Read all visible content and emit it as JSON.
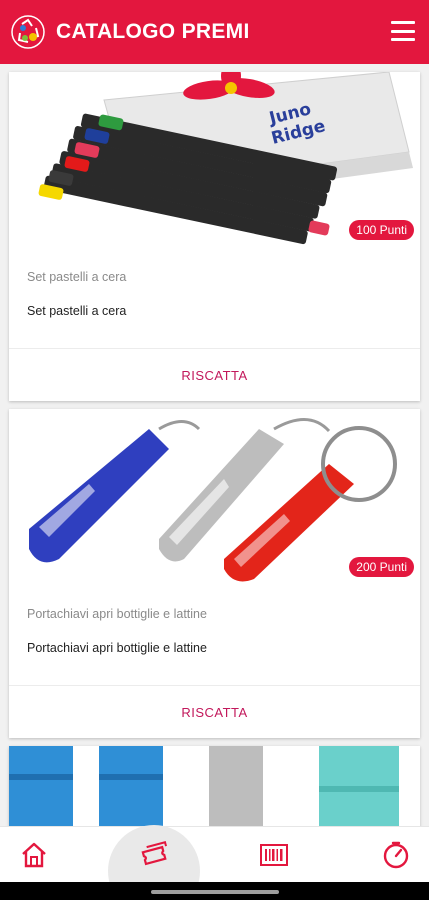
{
  "appbar": {
    "title": "CATALOGO PREMI",
    "logo_icon": "recycle-logo-icon",
    "menu_icon": "hamburger-menu-icon",
    "background": "#e3173e"
  },
  "catalog": {
    "items": [
      {
        "points_badge": "100 Punti",
        "subtitle": "Set pastelli a cera",
        "description": "Set pastelli a cera",
        "action_label": "RISCATTA",
        "image_icon": "crayon-set-image"
      },
      {
        "points_badge": "200 Punti",
        "subtitle": "Portachiavi apri bottiglie e lattine",
        "description": "Portachiavi apri bottiglie e lattine",
        "action_label": "RISCATTA",
        "image_icon": "bottle-opener-keychain-image"
      },
      {
        "image_icon": "highlighter-markers-image"
      }
    ]
  },
  "bottom_nav": {
    "items": [
      {
        "icon": "home-icon",
        "active": false
      },
      {
        "icon": "tickets-icon",
        "active": true
      },
      {
        "icon": "barcode-icon",
        "active": false
      },
      {
        "icon": "timer-icon",
        "active": false
      }
    ],
    "accent": "#e3173e"
  }
}
